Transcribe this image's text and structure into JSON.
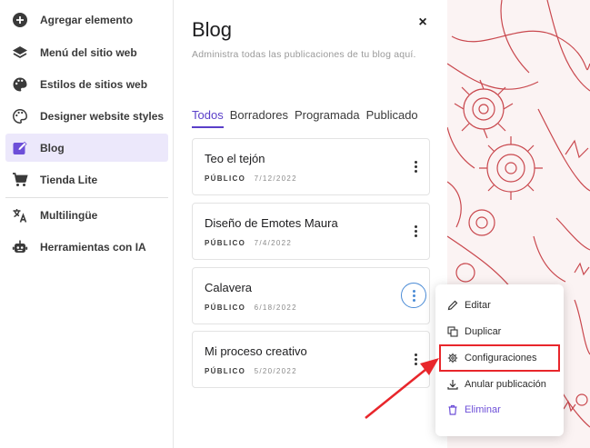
{
  "sidebar": {
    "items": [
      {
        "label": "Agregar elemento",
        "icon": "plus-circle-icon"
      },
      {
        "label": "Menú del sitio web",
        "icon": "layers-icon"
      },
      {
        "label": "Estilos de sitios web",
        "icon": "palette-icon"
      },
      {
        "label": "Designer website styles",
        "icon": "palette-outline-icon"
      },
      {
        "label": "Blog",
        "icon": "pencil-square-icon",
        "active": true
      },
      {
        "label": "Tienda Lite",
        "icon": "cart-icon"
      },
      {
        "label": "Multilingüe",
        "icon": "translate-icon"
      },
      {
        "label": "Herramientas con IA",
        "icon": "robot-icon"
      }
    ]
  },
  "panel": {
    "title": "Blog",
    "close": "×",
    "description": "Administra todas las publicaciones de tu blog aquí.",
    "tabs": [
      "Todos",
      "Borradores",
      "Programada",
      "Publicado"
    ],
    "active_tab": "Todos",
    "posts": [
      {
        "title": "Teo el tejón",
        "status": "PÚBLICO",
        "date": "7/12/2022"
      },
      {
        "title": "Diseño de Emotes Maura",
        "status": "PÚBLICO",
        "date": "7/4/2022"
      },
      {
        "title": "Calavera",
        "status": "PÚBLICO",
        "date": "6/18/2022"
      },
      {
        "title": "Mi proceso creativo",
        "status": "PÚBLICO",
        "date": "5/20/2022"
      }
    ]
  },
  "menu": {
    "items": [
      {
        "label": "Editar",
        "icon": "pencil-icon"
      },
      {
        "label": "Duplicar",
        "icon": "duplicate-icon"
      },
      {
        "label": "Configuraciones",
        "icon": "gear-icon"
      },
      {
        "label": "Anular publicación",
        "icon": "download-icon"
      },
      {
        "label": "Eliminar",
        "icon": "trash-icon"
      }
    ]
  },
  "colors": {
    "accent": "#6d4fd8",
    "active_bg": "#ece8fb",
    "highlight": "#e8262b",
    "art_line": "#c9484e"
  }
}
